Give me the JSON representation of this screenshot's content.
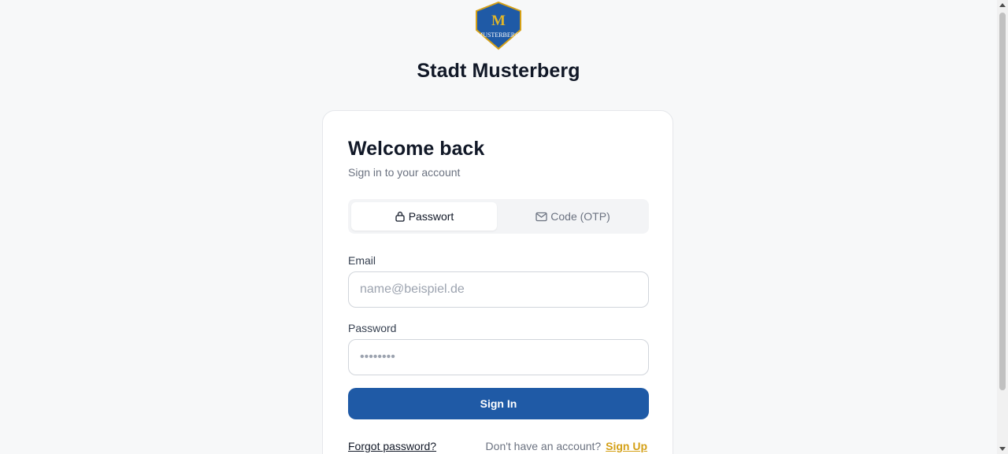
{
  "brand": {
    "logo_letter": "M",
    "logo_text": "MUSTERBERG",
    "name": "Stadt Musterberg",
    "colors": {
      "shield": "#1f5aa6",
      "shield_border": "#d4a017",
      "primary": "#1f5aa6",
      "accent": "#d4a017"
    }
  },
  "login": {
    "title": "Welcome back",
    "subtitle": "Sign in to your account",
    "tabs": [
      {
        "label": "Passwort",
        "icon": "lock-icon",
        "active": true
      },
      {
        "label": "Code (OTP)",
        "icon": "mail-icon",
        "active": false
      }
    ],
    "email": {
      "label": "Email",
      "placeholder": "name@beispiel.de",
      "value": ""
    },
    "password": {
      "label": "Password",
      "placeholder": "••••••••",
      "value": ""
    },
    "submit_label": "Sign In",
    "forgot_label": "Forgot password?",
    "signup_prompt": "Don't have an account?",
    "signup_label": "Sign Up"
  }
}
